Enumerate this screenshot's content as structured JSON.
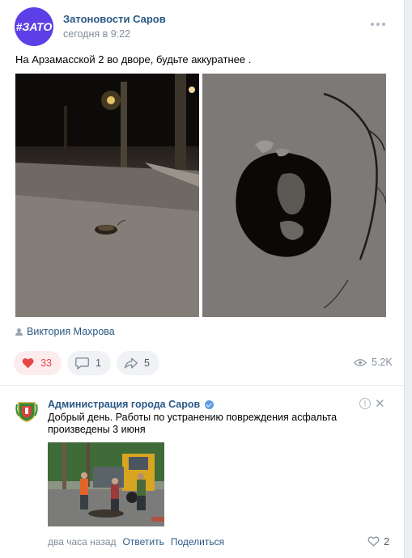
{
  "post": {
    "group_avatar_text": "#ЗАТО",
    "author": "Затоновости Саров",
    "time": "сегодня в 9:22",
    "text": "На Арзамасской 2 во дворе, будьте аккуратнее .",
    "signer": "Виктория Махрова",
    "likes": "33",
    "comments": "1",
    "shares": "5",
    "views": "5.2K",
    "colors": {
      "accent": "#5c3fe6",
      "link": "#2a5885",
      "like": "#e64646"
    }
  },
  "comment": {
    "author": "Администрация города Саров",
    "text": "Добрый день. Работы по устранению повреждения асфальта произведены 3 июня",
    "time": "два часа назад",
    "reply_label": "Ответить",
    "share_label": "Поделиться",
    "likes": "2",
    "close_glyph": "✕",
    "report_glyph": "!"
  }
}
